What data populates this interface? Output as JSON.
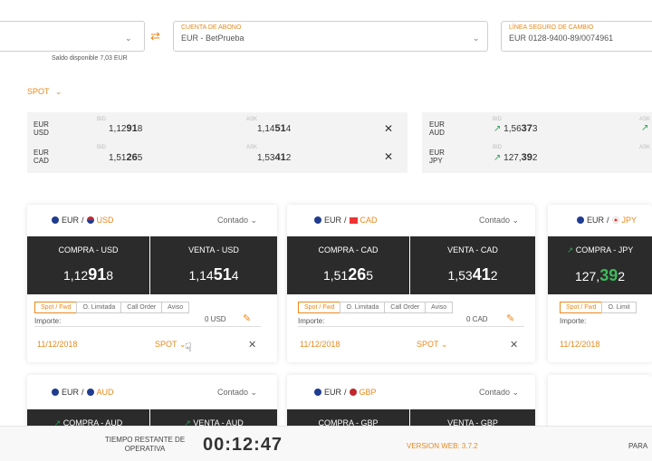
{
  "header": {
    "account_label": "CUENTA DE ABONO",
    "account_value": "EUR - BetPrueba",
    "line_label": "LÍNEA SEGURO DE CAMBIO",
    "line_value": "EUR 0128-9400-89/0074961",
    "saldo_label": "Saldo disponible",
    "saldo_value": "7,03 EUR",
    "mode": "SPOT",
    "swap_icon": "swap-arrows-icon",
    "chevron_icon": "chevron-down-icon"
  },
  "rates_table": {
    "bid_caption": "BID",
    "ask_caption": "ASK",
    "left": [
      {
        "base": "EUR",
        "quote": "USD",
        "bid_pre": "1,12",
        "bid_big": "91",
        "bid_post": "8",
        "ask_pre": "1,14",
        "ask_big": "51",
        "ask_post": "4"
      },
      {
        "base": "EUR",
        "quote": "CAD",
        "bid_pre": "1,51",
        "bid_big": "26",
        "bid_post": "5",
        "ask_pre": "1,53",
        "ask_big": "41",
        "ask_post": "2"
      }
    ],
    "right": [
      {
        "base": "EUR",
        "quote": "AUD",
        "bid_pre": "1,56",
        "bid_big": "37",
        "bid_post": "3"
      },
      {
        "base": "EUR",
        "quote": "JPY",
        "bid_pre": "127,",
        "bid_big": "39",
        "bid_post": "2"
      }
    ]
  },
  "cards": [
    {
      "base": "EUR",
      "quote": "USD",
      "type": "Contado",
      "buy_label": "COMPRA - USD",
      "sell_label": "VENTA - USD",
      "buy_pre": "1,12",
      "buy_big": "91",
      "buy_post": "8",
      "sell_pre": "1,14",
      "sell_big": "51",
      "sell_post": "4",
      "tabs": [
        "Spot / Fwd",
        "O. Limitada",
        "Call Order",
        "Aviso"
      ],
      "importe_label": "Importe:",
      "importe_value": "0 USD",
      "date": "11/12/2018",
      "spot": "SPOT"
    },
    {
      "base": "EUR",
      "quote": "CAD",
      "type": "Contado",
      "buy_label": "COMPRA - CAD",
      "sell_label": "VENTA - CAD",
      "buy_pre": "1,51",
      "buy_big": "26",
      "buy_post": "5",
      "sell_pre": "1,53",
      "sell_big": "41",
      "sell_post": "2",
      "tabs": [
        "Spot / Fwd",
        "O. Limitada",
        "Call Order",
        "Aviso"
      ],
      "importe_label": "Importe:",
      "importe_value": "0 CAD",
      "date": "11/12/2018",
      "spot": "SPOT"
    },
    {
      "base": "EUR",
      "quote": "JPY",
      "buy_label": "COMPRA - JPY",
      "buy_pre": "127,",
      "buy_big": "39",
      "buy_post": "2",
      "tabs": [
        "Spot / Fwd",
        "O. Limit"
      ],
      "importe_label": "Importe:",
      "date": "11/12/2018"
    },
    {
      "base": "EUR",
      "quote": "AUD",
      "type": "Contado",
      "buy_label": "COMPRA - AUD",
      "sell_label": "VENTA - AUD"
    },
    {
      "base": "EUR",
      "quote": "GBP",
      "type": "Contado",
      "buy_label": "COMPRA - GBP",
      "sell_label": "VENTA - GBP"
    }
  ],
  "footer": {
    "remaining_label": "TIEMPO RESTANTE DE OPERATIVA",
    "timer": "00:12:47",
    "version": "VERSION WEB: 3.7.2",
    "right_text": "PARA"
  },
  "colors": {
    "accent": "#e8891d",
    "dark": "#2b2b2b",
    "up": "#2ca05a"
  }
}
